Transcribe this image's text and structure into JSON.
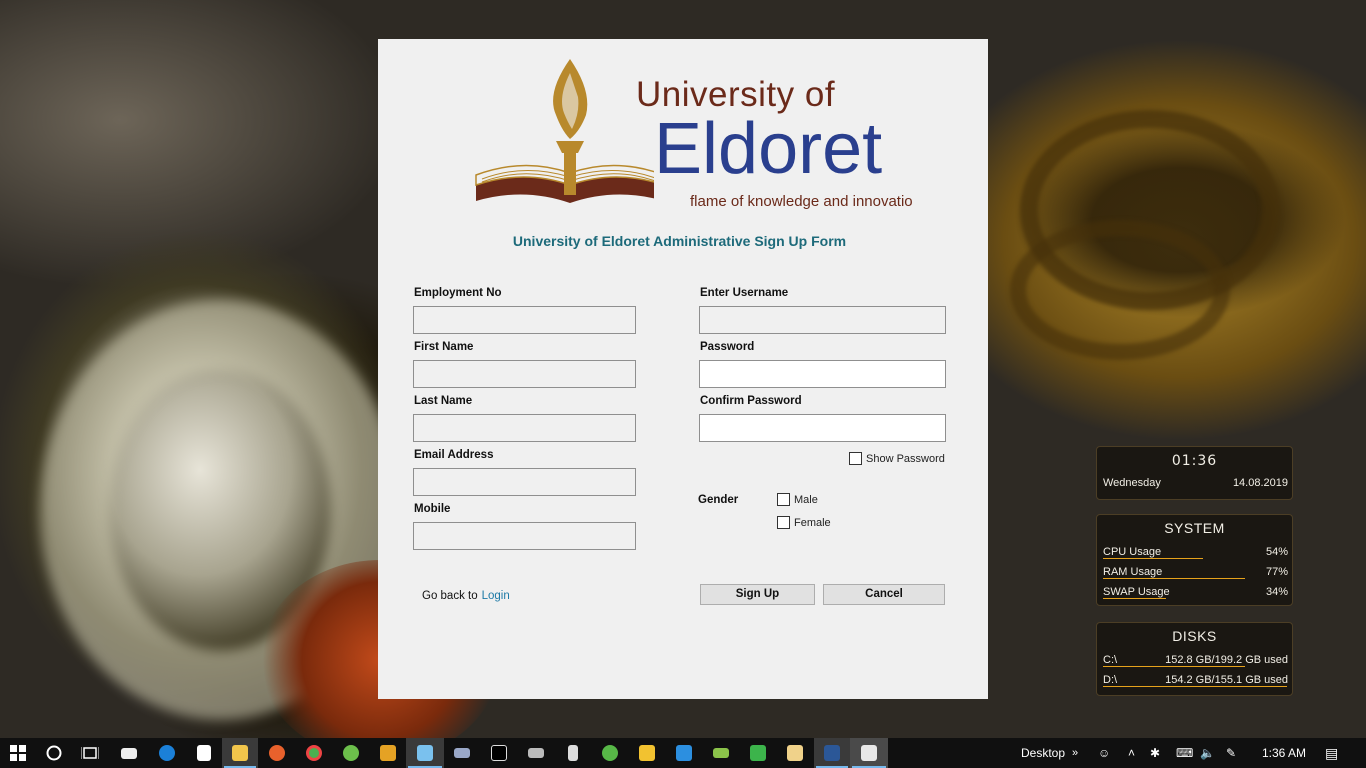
{
  "window": {
    "logo": {
      "line1": "University of",
      "line2": "Eldoret",
      "tagline": "flame of knowledge and innovatio"
    },
    "form_title": "University of Eldoret Administrative Sign Up Form",
    "left_fields": [
      {
        "label": "Employment No",
        "value": ""
      },
      {
        "label": "First Name",
        "value": ""
      },
      {
        "label": "Last Name",
        "value": ""
      },
      {
        "label": "Email Address",
        "value": ""
      },
      {
        "label": "Mobile",
        "value": ""
      }
    ],
    "right_fields": [
      {
        "label": "Enter Username",
        "value": ""
      },
      {
        "label": "Password",
        "value": ""
      },
      {
        "label": "Confirm Password",
        "value": ""
      }
    ],
    "show_password_label": "Show Password",
    "gender_label": "Gender",
    "gender_options": [
      "Male",
      "Female"
    ],
    "go_back_text": "Go back to",
    "login_link": "Login",
    "signup_button": "Sign Up",
    "cancel_button": "Cancel"
  },
  "widgets": {
    "clock": {
      "time": "01:36",
      "day": "Wednesday",
      "date": "14.08.2019"
    },
    "system": {
      "title": "SYSTEM",
      "rows": [
        {
          "label": "CPU Usage",
          "value": "54%",
          "fraction": 0.54
        },
        {
          "label": "RAM Usage",
          "value": "77%",
          "fraction": 0.77
        },
        {
          "label": "SWAP Usage",
          "value": "34%",
          "fraction": 0.34
        }
      ]
    },
    "disks": {
      "title": "DISKS",
      "rows": [
        {
          "label": "C:\\",
          "value": "152.8 GB/199.2 GB used",
          "fraction": 0.767
        },
        {
          "label": "D:\\",
          "value": "154.2 GB/155.1 GB used",
          "fraction": 0.994
        }
      ]
    }
  },
  "taskbar": {
    "desktop_label": "Desktop",
    "time": "1:36 AM",
    "accent": "#76b9ed"
  }
}
